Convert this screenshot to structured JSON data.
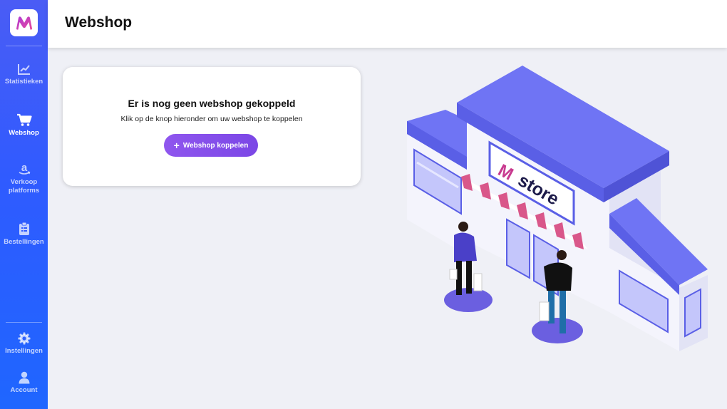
{
  "app": {
    "logo_letter": "M",
    "accent": "#8f56ee",
    "sidebar_gradient": [
      "#4a5cf5",
      "#1f66ff"
    ]
  },
  "sidebar": {
    "items": [
      {
        "label": "Statistieken",
        "icon": "chart-line-icon",
        "active": false
      },
      {
        "label": "Webshop",
        "icon": "shopping-cart-icon",
        "active": true
      },
      {
        "label": "Verkoop platforms",
        "icon": "amazon-icon",
        "active": false
      },
      {
        "label": "Bestellingen",
        "icon": "clipboard-list-icon",
        "active": false
      }
    ],
    "bottom_items": [
      {
        "label": "Instellingen",
        "icon": "gear-icon"
      },
      {
        "label": "Account",
        "icon": "user-icon"
      }
    ]
  },
  "header": {
    "title": "Webshop"
  },
  "empty_state": {
    "title": "Er is nog geen webshop gekoppeld",
    "subtitle": "Klik op de knop hieronder om uw webshop te koppelen",
    "button_label": "Webshop koppelen",
    "button_icon": "plus-icon"
  },
  "illustration": {
    "sign_text": "store",
    "sign_letter": "M",
    "colors": {
      "roof": "#6f74f4",
      "wall": "#f4f4fc",
      "awning": "#d9578a",
      "shadow": "#6b5fe0"
    }
  }
}
